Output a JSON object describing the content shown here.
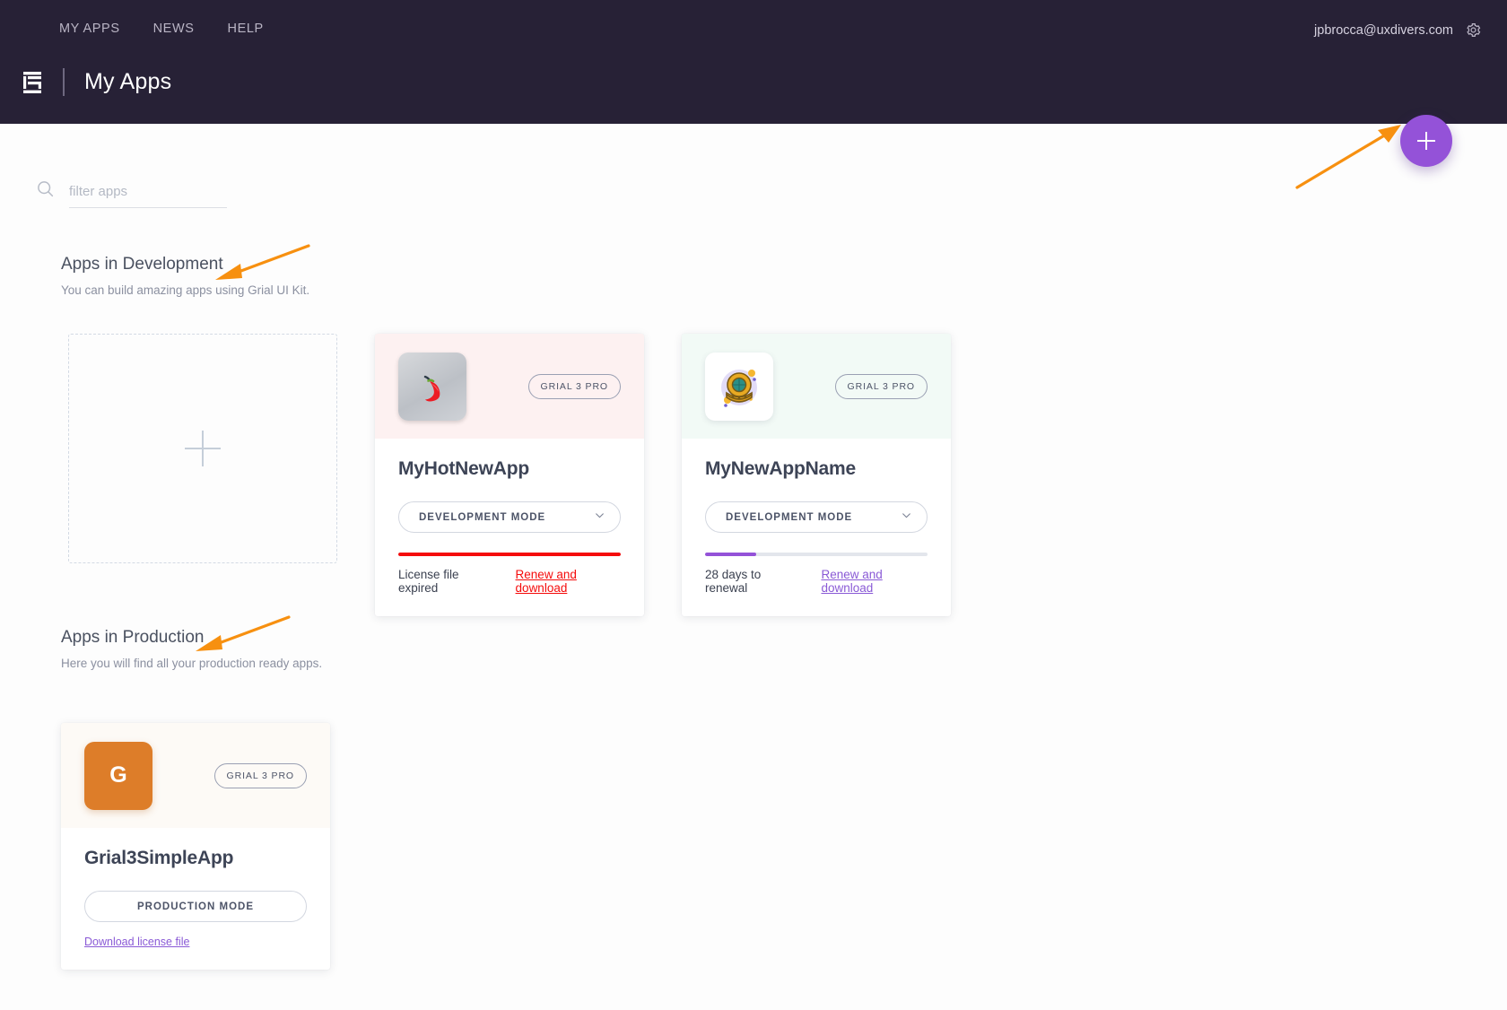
{
  "header": {
    "nav": [
      {
        "label": "MY APPS"
      },
      {
        "label": "NEWS"
      },
      {
        "label": "HELP"
      }
    ],
    "account_email": "jpbrocca@uxdivers.com",
    "settings_icon": "gear-icon",
    "logo_icon": "grial-logo-icon",
    "title": "My Apps",
    "fab_icon": "plus-icon",
    "bg_color": "#272136",
    "accent_color": "#9452d8"
  },
  "search": {
    "icon": "search-icon",
    "placeholder": "filter apps",
    "value": ""
  },
  "sections": {
    "development": {
      "title": "Apps in Development",
      "subtitle": "You can build amazing apps using Grial UI Kit."
    },
    "production": {
      "title": "Apps in Production",
      "subtitle": "Here you will find all your production ready apps."
    }
  },
  "placeholder_card": {
    "icon": "plus-icon"
  },
  "dev_apps": [
    {
      "name": "MyHotNewApp",
      "icon": "chili-pepper-icon",
      "badge": "GRIAL 3 PRO",
      "mode_label": "DEVELOPMENT MODE",
      "has_chevron": true,
      "progress_percent": 100,
      "progress_color": "#f50b0b",
      "status_text": "License file expired",
      "link_text": "Renew and download",
      "link_color": "#f50b0b",
      "header_bg": "#fdf1f1"
    },
    {
      "name": "MyNewAppName",
      "icon": "diving-helmet-icon",
      "badge": "GRIAL 3 PRO",
      "mode_label": "DEVELOPMENT MODE",
      "has_chevron": true,
      "progress_percent": 23,
      "progress_color": "#9452d8",
      "status_text": "28 days to renewal",
      "link_text": "Renew and download",
      "link_color": "#8a5ad6",
      "header_bg": "#f2faf6"
    }
  ],
  "prod_apps": [
    {
      "name": "Grial3SimpleApp",
      "icon": "letter-g-icon",
      "icon_letter": "G",
      "badge": "GRIAL 3 PRO",
      "mode_label": "PRODUCTION MODE",
      "has_chevron": false,
      "link_text": "Download license file",
      "link_color": "#8a5ad6",
      "header_bg": "#fdfaf6"
    }
  ],
  "annotations": {
    "color": "#f79010",
    "arrows": [
      {
        "target": "add-app-fab"
      },
      {
        "target": "apps-in-development-title"
      },
      {
        "target": "apps-in-production-title"
      }
    ]
  }
}
